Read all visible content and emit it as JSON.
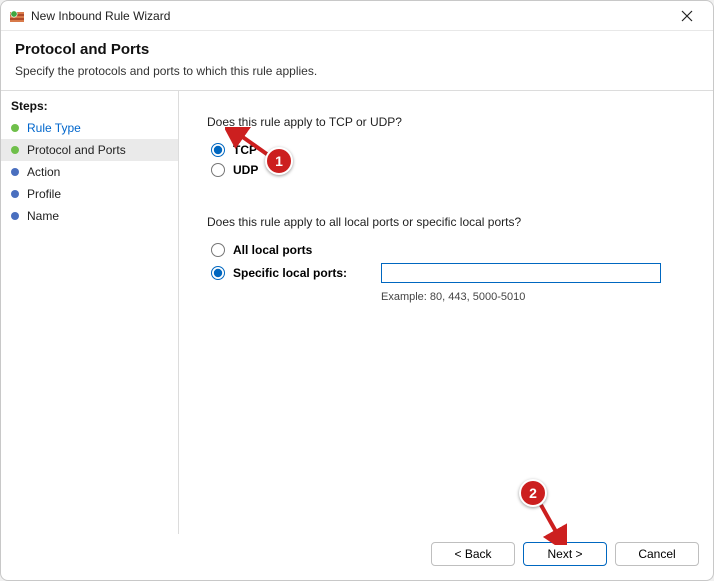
{
  "window": {
    "title": "New Inbound Rule Wizard"
  },
  "header": {
    "title": "Protocol and Ports",
    "subtitle": "Specify the protocols and ports to which this rule applies."
  },
  "steps": {
    "heading": "Steps:",
    "items": [
      {
        "label": "Rule Type"
      },
      {
        "label": "Protocol and Ports"
      },
      {
        "label": "Action"
      },
      {
        "label": "Profile"
      },
      {
        "label": "Name"
      }
    ]
  },
  "content": {
    "protocol_question": "Does this rule apply to TCP or UDP?",
    "protocol_options": {
      "tcp": "TCP",
      "udp": "UDP"
    },
    "ports_question": "Does this rule apply to all local ports or specific local ports?",
    "ports_options": {
      "all": "All local ports",
      "specific": "Specific local ports:"
    },
    "ports_input_value": "",
    "ports_example": "Example: 80, 443, 5000-5010"
  },
  "buttons": {
    "back": "< Back",
    "next": "Next >",
    "cancel": "Cancel"
  },
  "annotations": {
    "b1": "1",
    "b2": "2"
  }
}
